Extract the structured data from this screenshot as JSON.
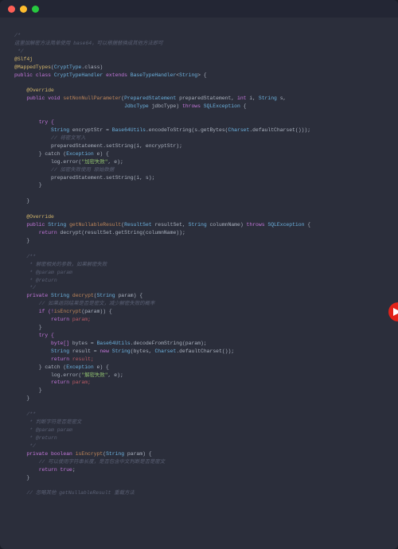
{
  "window_controls": {
    "close": "close",
    "minimize": "minimize",
    "zoom": "zoom"
  },
  "lines": {
    "c1a": "/*",
    "c1b": "这里加解密方法简单使用 base64，可以根据替换成其他方法即可",
    "c1c": " */",
    "ann1": "@Slf4j",
    "ann2_a": "@MappedTypes",
    "ann2_b": "(",
    "ann2_c": "CryptType",
    "ann2_d": ".class)",
    "cls_a": "public class ",
    "cls_b": "CryptTypeHandler",
    "cls_c": " extends ",
    "cls_d": "BaseTypeHandler",
    "cls_e": "<",
    "cls_f": "String",
    "cls_g": "> {",
    "ov1": "@Override",
    "m1_a": "public void ",
    "m1_b": "setNonNullParameter",
    "m1_c": "(",
    "m1_d": "PreparedStatement",
    "m1_e": " preparedStatement, ",
    "m1_f": "int",
    "m1_g": " i, ",
    "m1_h": "String",
    "m1_i": " s,",
    "m1_j": "JdbcType",
    "m1_k": " jdbcType) ",
    "m1_l": "throws ",
    "m1_m": "SQLException",
    "m1_n": " {",
    "try1": "try {",
    "l1_a": "String",
    "l1_b": " encryptStr = ",
    "l1_c": "Base64Utils",
    "l1_d": ".encodeToString(s.getBytes(",
    "l1_e": "Charset",
    "l1_f": ".defaultCharset()));",
    "c2": "// 将密文写入",
    "l2": "preparedStatement.setString(i, encryptStr);",
    "catch1_a": "} catch (",
    "catch1_b": "Exception",
    "catch1_c": " e) {",
    "l3_a": "log.error(",
    "l3_b": "\"加密失败\"",
    "l3_c": ", e);",
    "c3": "// 加密失败使用 原始数据",
    "l4": "preparedStatement.setString(i, s);",
    "rb": "}",
    "ov2": "@Override",
    "m2_a": "public ",
    "m2_b": "String ",
    "m2_c": "getNullableResult",
    "m2_d": "(",
    "m2_e": "ResultSet",
    "m2_f": " resultSet, ",
    "m2_g": "String",
    "m2_h": " columnName) ",
    "m2_i": "throws ",
    "m2_j": "SQLException",
    "m2_k": " {",
    "m2_body_a": "return ",
    "m2_body_b": "decrypt(resultSet.getString(columnName));",
    "doc1a": "/**",
    "doc1b": " * 解密相关的参数，如果解密失败",
    "doc1c": " * @param param",
    "doc1d": " * @return",
    "doc1e": " */",
    "m3_a": "private ",
    "m3_b": "String ",
    "m3_c": "decrypt",
    "m3_d": "(",
    "m3_e": "String",
    "m3_f": " param) {",
    "c4": "// 如果返回结果是否是密文，减少解密失败的概率",
    "if1_a": "if (!",
    "if1_b": "isEncrypt",
    "if1_c": "(param)) {",
    "ret1_a": "return ",
    "ret1_b": "param;",
    "try2": "try {",
    "l5_a": "byte[] ",
    "l5_b": "bytes = ",
    "l5_c": "Base64Utils",
    "l5_d": ".decodeFromString(param);",
    "l6_a": "String ",
    "l6_b": "result = ",
    "l6_c": "new ",
    "l6_d": "String",
    "l6_e": "(bytes, ",
    "l6_f": "Charset",
    "l6_g": ".defaultCharset());",
    "ret2_a": "return ",
    "ret2_b": "result;",
    "catch2_a": "} catch (",
    "catch2_b": "Exception",
    "catch2_c": " e) {",
    "l7_a": "log.error(",
    "l7_b": "\"解密失败\"",
    "l7_c": ", e);",
    "ret3_a": "return ",
    "ret3_b": "param;",
    "doc2a": "/**",
    "doc2b": " * 判断字符是否是密文",
    "doc2c": " * @param param",
    "doc2d": " * @return",
    "doc2e": " */",
    "m4_a": "private boolean ",
    "m4_b": "isEncrypt",
    "m4_c": "(",
    "m4_d": "String",
    "m4_e": " param) {",
    "c5": "// 可以使用字符串长度，是否包含中文判断是否是密文",
    "ret4_a": "return ",
    "ret4_b": "true",
    "ret4_c": ";",
    "c6": "// 忽略其他 getNullableResult 重载方法"
  }
}
